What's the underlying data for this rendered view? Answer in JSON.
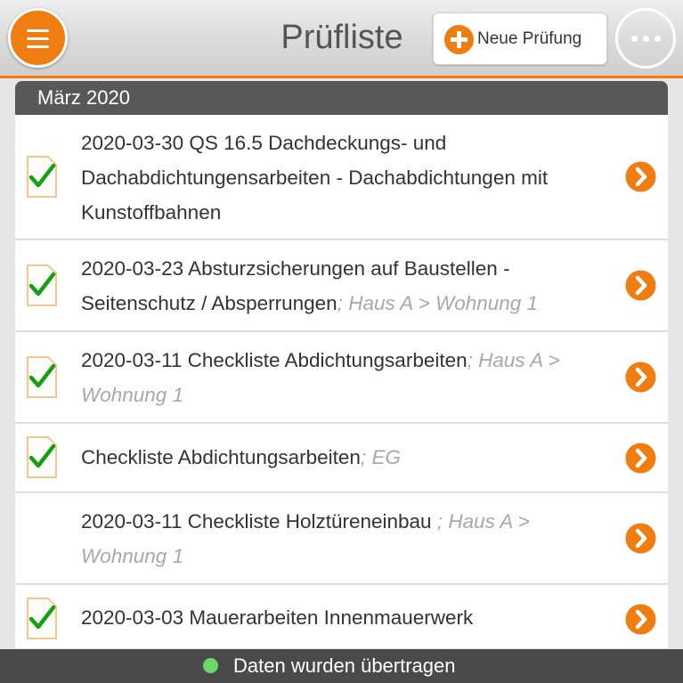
{
  "header": {
    "title": "Prüfliste",
    "new_button_label": "Neue Prüfung",
    "menu_icon": "hamburger-menu-icon",
    "more_icon": "more-dots-icon"
  },
  "section": {
    "label": "März 2020"
  },
  "items": [
    {
      "title": "2020-03-30 QS 16.5 Dachdeckungs- und Dachabdichtungensarbeiten - Dachabdichtungen mit Kunstoffbahnen",
      "location": "",
      "checked": true
    },
    {
      "title": "2020-03-23 Absturzsicherungen auf Baustellen - Seitenschutz / Absperrungen",
      "location": "; Haus A > Wohnung 1",
      "checked": true
    },
    {
      "title": "2020-03-11 Checkliste Abdichtungsarbeiten",
      "location": "; Haus A > Wohnung 1",
      "checked": true
    },
    {
      "title": "Checkliste Abdichtungsarbeiten",
      "location": "; EG",
      "checked": true
    },
    {
      "title": "2020-03-11 Checkliste Holztüreneinbau ",
      "location": "; Haus A > Wohnung 1",
      "checked": false
    },
    {
      "title": "2020-03-03 Mauerarbeiten Innenmauerwerk",
      "location": "",
      "checked": true
    }
  ],
  "footer": {
    "status_text": "Daten wurden übertragen"
  },
  "colors": {
    "accent": "#ef7d0f",
    "check": "#14a014",
    "status_ok": "#6bd86b",
    "dark_bar": "#585858"
  }
}
